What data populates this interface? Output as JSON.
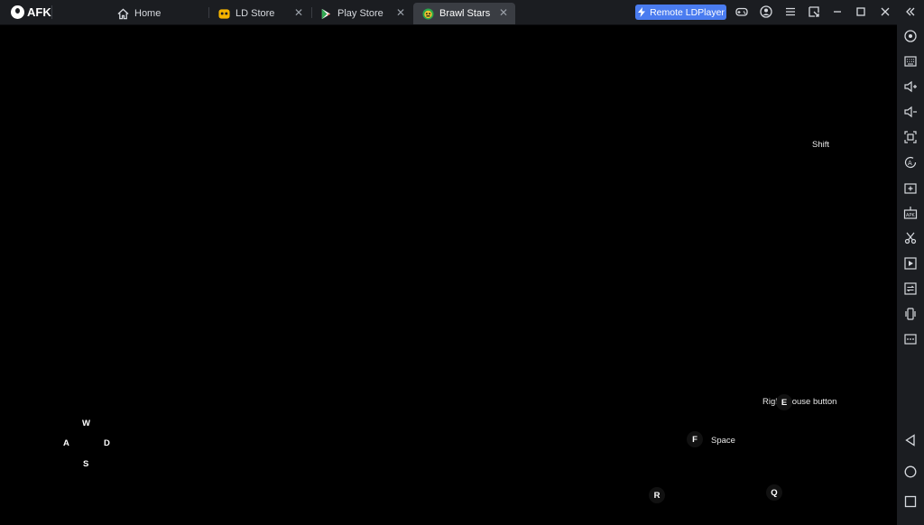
{
  "app": {
    "logo_text": "AFK"
  },
  "tabs": [
    {
      "label": "Home",
      "icon": "home-icon",
      "closable": false,
      "active": false
    },
    {
      "label": "LD Store",
      "icon": "ld-store-icon",
      "closable": true,
      "active": false
    },
    {
      "label": "Play Store",
      "icon": "play-store-icon",
      "closable": true,
      "active": false
    },
    {
      "label": "Brawl Stars",
      "icon": "brawl-stars-icon",
      "closable": true,
      "active": true
    }
  ],
  "toolbar": {
    "remote_label": "Remote LDPlayer",
    "icons": [
      "gamepad-icon",
      "account-icon",
      "menu-icon",
      "window-switch-icon",
      "minimize-icon",
      "maximize-icon",
      "close-icon",
      "collapse-sidebar-icon"
    ]
  },
  "sidebar": {
    "icons": [
      "record-icon",
      "keyboard-icon",
      "volume-up-icon",
      "volume-down-icon",
      "fullscreen-icon",
      "auto-script-icon",
      "add-app-icon",
      "apk-install-icon",
      "scissors-icon",
      "video-record-icon",
      "sync-icon",
      "shake-icon",
      "more-icon",
      "back-icon",
      "home-nav-icon",
      "recent-apps-icon"
    ]
  },
  "keymap": {
    "shift": "Shift",
    "w": "W",
    "a": "A",
    "s": "S",
    "d": "D",
    "right_mouse": "Right mouse button",
    "e": "E",
    "f": "F",
    "space": "Space",
    "r": "R",
    "q": "Q"
  },
  "colors": {
    "topbar_bg": "#1b1d21",
    "active_tab_bg": "#3a3d43",
    "remote_button_bg": "#4a7cf0",
    "game_bg": "#000000"
  }
}
